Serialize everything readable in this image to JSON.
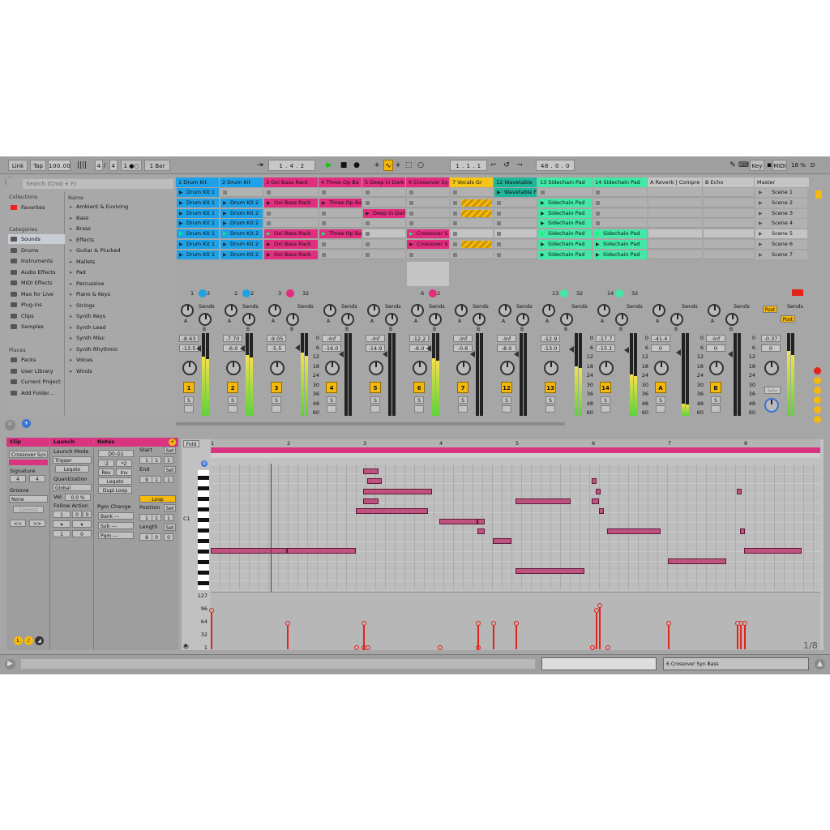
{
  "toolbar": {
    "link": "Link",
    "tap": "Tap",
    "tempo": "100.00",
    "meter_glyph": "||||",
    "sig_num": "4",
    "sig_slash": "/",
    "sig_den": "4",
    "metro": "1 ●○",
    "quant": "1 Bar",
    "arr_pos": "1 .   4 .   2",
    "loop_start": "1 .   1 .   1",
    "loop_len": "48 .   0 .   0",
    "key": "Key",
    "midi": "MIDI",
    "cpu": "18 %",
    "d": "D"
  },
  "browser": {
    "search_placeholder": "Search (Cmd + F)",
    "collections_label": "Collections",
    "favorites": "Favorites",
    "categories_label": "Categories",
    "categories": [
      "Sounds",
      "Drums",
      "Instruments",
      "Audio Effects",
      "MIDI Effects",
      "Max for Live",
      "Plug-ins",
      "Clips",
      "Samples"
    ],
    "places_label": "Places",
    "places": [
      "Packs",
      "User Library",
      "Current Project",
      "Add Folder..."
    ],
    "name_header": "Name",
    "items": [
      "Ambient & Evolving",
      "Bass",
      "Brass",
      "Effects",
      "Guitar & Plucked",
      "Mallets",
      "Pad",
      "Percussive",
      "Piano & Keys",
      "Strings",
      "Synth Keys",
      "Synth Lead",
      "Synth Misc",
      "Synth Rhythmic",
      "Voices",
      "Winds"
    ]
  },
  "tracks": [
    {
      "name": "1 Drum Kit",
      "color": "#1ea1e6",
      "clips": [
        "Drum Kit 1",
        "Drum Kit 1",
        "Drum Kit 1",
        "Drum Kit 1",
        "Drum Kit 1",
        "Drum Kit 1",
        "Drum Kit 1"
      ],
      "vol": "-8.63",
      "pan": "-13.5",
      "num": "1",
      "out": "32",
      "level": 0.72
    },
    {
      "name": "2 Drum Kit",
      "color": "#1ea1e6",
      "clips": [
        "",
        "Drum Kit 2",
        "Drum Kit 2",
        "Drum Kit 2",
        "Drum Kit 2",
        "Drum Kit 2",
        "Drum Kit 2"
      ],
      "vol": "-7.70",
      "pan": "-6.0",
      "num": "2",
      "out": "32",
      "level": 0.74
    },
    {
      "name": "3 Oxi Bass Rack",
      "color": "#e22e7e",
      "clips": [
        "",
        "Oxi Bass Rack",
        "",
        "",
        "Oxi Bass Rack",
        "Oxi Bass Rack",
        "Oxi Bass Rack"
      ],
      "vol": "-9.05",
      "pan": "-5.5",
      "num": "3",
      "out": "32",
      "level": 0.76
    },
    {
      "name": "4 Three Op Ba",
      "color": "#e22e7e",
      "clips": [
        "",
        "Three Op Ba",
        "",
        "",
        "Three Op Ba",
        "",
        ""
      ],
      "vol": "-Inf",
      "pan": "-16.0",
      "num": "4",
      "out": "",
      "level": 0
    },
    {
      "name": "5 Deep in Dark",
      "color": "#e22e7e",
      "clips": [
        "",
        "",
        "Deep in Dark",
        "",
        "",
        "",
        ""
      ],
      "vol": "-Inf",
      "pan": "-14.9",
      "num": "5",
      "out": "",
      "level": 0
    },
    {
      "name": "6 Crossover Sy",
      "color": "#e22e7e",
      "clips": [
        "",
        "",
        "",
        "",
        "Crossover S",
        "Crossover S",
        ""
      ],
      "vol": "-12.2",
      "pan": "-6.0",
      "num": "6",
      "out": "32",
      "level": 0.7
    },
    {
      "name": "7 Vocals Gr",
      "color": "#f5c518",
      "clips": [
        "",
        "hatch",
        "hatch",
        "",
        "",
        "hatch",
        ""
      ],
      "vol": "-Inf",
      "pan": "-0.6",
      "num": "7",
      "out": "",
      "level": 0
    },
    {
      "name": "12 Wavetable",
      "color": "#1fb59a",
      "clips": [
        "Wavetable F",
        "",
        "",
        "",
        "",
        "",
        ""
      ],
      "vol": "-Inf",
      "pan": "-8.0",
      "num": "12",
      "out": "",
      "level": 0
    },
    {
      "name": "13 Sidechain Pad",
      "color": "#42e8a6",
      "clips": [
        "",
        "Sidechain Pad",
        "Sidechain Pad",
        "Sidechain Pad",
        "Sidechain Pad",
        "Sidechain Pad",
        "Sidechain Pad"
      ],
      "vol": "-12.9",
      "pan": "-13.0",
      "num": "13",
      "out": "32",
      "level": 0.6
    },
    {
      "name": "14 Sidechain Pad",
      "color": "#42e8a6",
      "clips": [
        "",
        "",
        "",
        "",
        "Sidechain Pad",
        "Sidechain Pad",
        "Sidechain Pad"
      ],
      "vol": "-17.7",
      "pan": "-15.1",
      "num": "14",
      "out": "32",
      "level": 0.5
    },
    {
      "name": "A Reverb | Compre",
      "color": "#c4c4c4",
      "clips": [],
      "vol": "-41.4",
      "pan": "0",
      "num": "A",
      "out": "",
      "level": 0.15
    },
    {
      "name": "B Echo",
      "color": "#c4c4c4",
      "clips": [],
      "vol": "-Inf",
      "pan": "0",
      "num": "B",
      "out": "",
      "level": 0
    }
  ],
  "master": {
    "name": "Master",
    "scenes": [
      "Scene 1",
      "Scene 2",
      "Scene 3",
      "Scene 4",
      "Scene 5",
      "Scene 6",
      "Scene 7"
    ],
    "vol": "-0.37",
    "pan": "0",
    "post": "Post",
    "solo": "Solo",
    "level": 0.78
  },
  "mixer": {
    "sends_label": "Sends",
    "a": "A",
    "b": "B",
    "s": "S",
    "db_scale": [
      "0",
      "6",
      "12",
      "18",
      "24",
      "30",
      "36",
      "48",
      "60"
    ]
  },
  "clip_view": {
    "clip_tab": "Clip",
    "clip_name": "Crossover Syn",
    "signature_label": "Signature",
    "sig_num": "4",
    "sig_den": "4",
    "groove_label": "Groove",
    "groove": "None",
    "commit": "Commit",
    "launch_tab": "Launch",
    "launch_mode_label": "Launch Mode",
    "launch_mode": "Trigger",
    "legato": "Legato",
    "quant_label": "Quantization",
    "quant": "Global",
    "vel_label": "Vel",
    "vel": "0.0 %",
    "follow_label": "Follow Action",
    "fa1": "1",
    "fa2": "0",
    "fa3": "0",
    "notes_tab": "Notes",
    "range": "D0-G1",
    "half": ":2",
    "dbl": "*2",
    "rev": "Rev",
    "inv": "Inv",
    "legato2": "Legato",
    "dupl": "Dupl.Loop",
    "pgm_label": "Pgm Change",
    "bank": "Bank ---",
    "sub": "Sub ---",
    "pgm": "Pgm ---",
    "start_label": "Start",
    "set": "Set",
    "start": [
      "1",
      "1",
      "1"
    ],
    "end_label": "End",
    "end": [
      "9",
      "1",
      "1"
    ],
    "loop": "Loop",
    "position_label": "Position",
    "position": [
      "1",
      "1",
      "1"
    ],
    "length_label": "Length",
    "length": [
      "8",
      "0",
      "0"
    ],
    "nav_left": "<<",
    "nav_right": ">>"
  },
  "piano_roll": {
    "fold": "Fold",
    "bars": [
      "1",
      "2",
      "3",
      "4",
      "5",
      "6",
      "7",
      "8"
    ],
    "c1": "C1",
    "vel_ticks": [
      "127",
      "96",
      "64",
      "32",
      "1"
    ],
    "zoom": "1/8",
    "notes": [
      [
        0,
        8,
        1
      ],
      [
        1.0,
        8,
        0.9
      ],
      [
        1.9,
        4,
        0.95
      ],
      [
        2.0,
        3,
        0.2
      ],
      [
        2.05,
        1,
        0.2
      ],
      [
        2.0,
        0,
        0.2
      ],
      [
        2.0,
        2,
        0.9
      ],
      [
        3.0,
        5,
        0.5
      ],
      [
        3.5,
        5,
        0.1
      ],
      [
        3.5,
        6,
        0.1
      ],
      [
        3.7,
        7,
        0.25
      ],
      [
        4.0,
        3,
        0.72
      ],
      [
        4.0,
        10,
        0.9
      ],
      [
        5.0,
        3,
        0.1
      ],
      [
        5.05,
        2,
        0.05
      ],
      [
        5.1,
        4,
        0.05
      ],
      [
        5.0,
        1,
        0.05
      ],
      [
        5.2,
        6,
        0.7
      ],
      [
        6.0,
        9,
        0.77
      ],
      [
        6.95,
        6,
        0.05
      ],
      [
        6.9,
        2,
        0.05
      ],
      [
        7.0,
        8,
        0.75
      ]
    ],
    "velocities": [
      96,
      64,
      1,
      1,
      1,
      1,
      64,
      1,
      1,
      64,
      64,
      64,
      64,
      1,
      96,
      108,
      1,
      1,
      64,
      64,
      64,
      64
    ]
  },
  "status": {
    "track_label": "6 Crossover Syn Bass"
  }
}
